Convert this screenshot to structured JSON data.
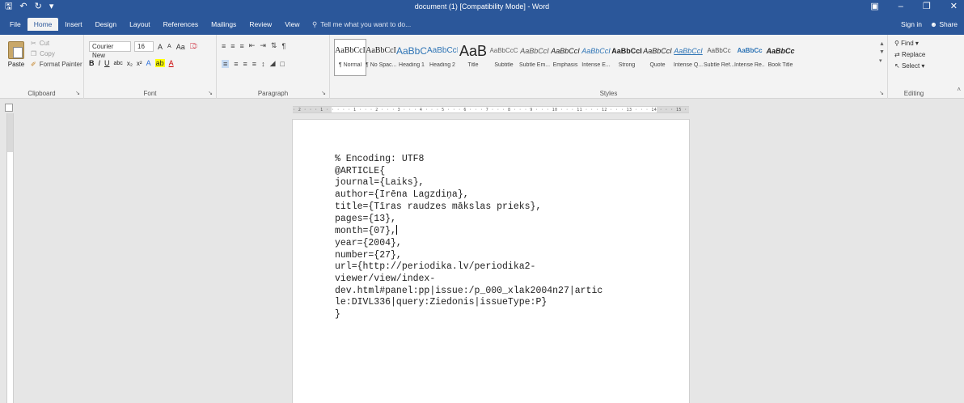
{
  "window": {
    "title": "document (1) [Compatibility Mode] - Word",
    "qat_icons": [
      "save-icon",
      "undo-icon",
      "redo-icon",
      "customize-qat-icon"
    ]
  },
  "tabs": [
    "File",
    "Home",
    "Insert",
    "Design",
    "Layout",
    "References",
    "Mailings",
    "Review",
    "View"
  ],
  "active_tab": "Home",
  "tell_me": "Tell me what you want to do...",
  "account": {
    "sign_in": "Sign in",
    "share": "Share"
  },
  "clipboard": {
    "paste": "Paste",
    "cut": "Cut",
    "copy": "Copy",
    "format_painter": "Format Painter",
    "label": "Clipboard"
  },
  "font": {
    "name": "Courier New",
    "size": "16",
    "label": "Font",
    "case_label": "Aa",
    "grow": "A",
    "shrink": "A"
  },
  "paragraph": {
    "label": "Paragraph"
  },
  "styles": {
    "label": "Styles",
    "items": [
      {
        "sample": "AaBbCcI",
        "name": "¶ Normal"
      },
      {
        "sample": "AaBbCcI",
        "name": "¶ No Spac..."
      },
      {
        "sample": "AaBbC",
        "name": "Heading 1"
      },
      {
        "sample": "AaBbCcI",
        "name": "Heading 2"
      },
      {
        "sample": "AaB",
        "name": "Title"
      },
      {
        "sample": "AaBbCcC",
        "name": "Subtitle"
      },
      {
        "sample": "AaBbCcI",
        "name": "Subtle Em..."
      },
      {
        "sample": "AaBbCcI",
        "name": "Emphasis"
      },
      {
        "sample": "AaBbCcI",
        "name": "Intense E..."
      },
      {
        "sample": "AaBbCcI",
        "name": "Strong"
      },
      {
        "sample": "AaBbCcI",
        "name": "Quote"
      },
      {
        "sample": "AaBbCcI",
        "name": "Intense Q..."
      },
      {
        "sample": "AaBbCc",
        "name": "Subtle Ref..."
      },
      {
        "sample": "AaBbCc",
        "name": "Intense Re..."
      },
      {
        "sample": "AaBbCc",
        "name": "Book Title"
      }
    ]
  },
  "editing": {
    "find": "Find",
    "replace": "Replace",
    "select": "Select",
    "label": "Editing"
  },
  "document": {
    "lines": [
      "% Encoding: UTF8",
      "@ARTICLE{",
      "journal={Laiks},",
      "author={Irēna Lagzdiņa},",
      "title={Tīras raudzes mākslas prieks},",
      "pages={13},",
      "month={07},",
      "year={2004},",
      "number={27},",
      "url={http://periodika.lv/periodika2-",
      "viewer/view/index-",
      "dev.html#panel:pp|issue:/p_000_xlak2004n27|artic",
      "le:DIVL336|query:Ziedonis|issueType:P}",
      "}"
    ]
  },
  "colors": {
    "accent": "#2b579a",
    "ribbon": "#f3f3f3",
    "canvas": "#e6e6e6"
  }
}
